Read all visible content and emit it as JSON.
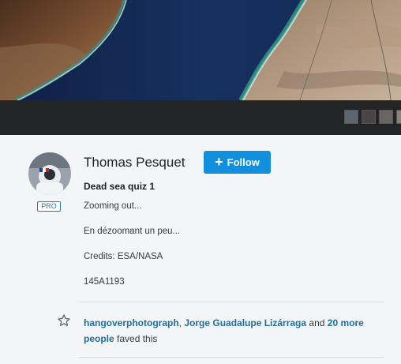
{
  "photo": {
    "thumbnails": [
      {
        "name": "thumb-1",
        "color": "#5c6670"
      },
      {
        "name": "thumb-2",
        "color": "#4a4446"
      },
      {
        "name": "thumb-3",
        "color": "#6a6462"
      },
      {
        "name": "thumb-4",
        "color": "#8a8478"
      }
    ]
  },
  "author": {
    "name": "Thomas Pesquet",
    "badge": "PRO",
    "avatar": "astronaut-avatar"
  },
  "follow": {
    "label": "Follow",
    "icon": "plus-icon"
  },
  "photo_info": {
    "title": "Dead sea quiz 1",
    "description": [
      "Zooming out...",
      "En dézoomant un peu...",
      "Credits: ESA/NASA",
      "145A1193"
    ]
  },
  "faves": {
    "icon": "star-icon",
    "user1": "hangoverphotograph",
    "sep": ", ",
    "user2": "Jorge Guadalupe Lizárraga",
    "and": " and ",
    "more": "20 more people",
    "suffix": " faved this"
  },
  "colors": {
    "accent": "#128fdc",
    "link": "#1c6ea4",
    "pro": "#1f7bbd"
  }
}
